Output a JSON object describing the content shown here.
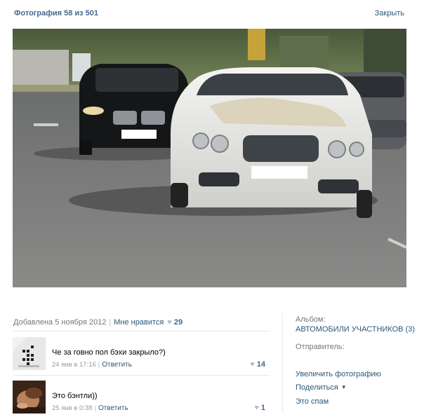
{
  "header": {
    "title": "Фотография 58 из 501",
    "close_label": "Закрыть"
  },
  "meta": {
    "added_text": "Добавлена 5 ноября 2012",
    "like_label": "Мне нравится",
    "heart_icon": "heart-icon",
    "like_count": "29"
  },
  "comments": [
    {
      "text": "Че за говно пол бэхи закрыло?)",
      "date": "24 янв в 17:16",
      "reply_label": "Ответить",
      "likes": "14"
    },
    {
      "text": "Это бэнтли))",
      "date": "25 янв в 0:38",
      "reply_label": "Ответить",
      "likes": "1"
    }
  ],
  "sidebar": {
    "album_label": "Альбом:",
    "album_name": "АВТОМОБИЛИ УЧАСТНИКОВ (3)",
    "sender_label": "Отправитель:",
    "enlarge_label": "Увеличить фотографию",
    "share_label": "Поделиться",
    "spam_label": "Это спам"
  },
  "colors": {
    "link": "#2b587a",
    "title": "#45688e",
    "heart": "#a9bdd2"
  }
}
